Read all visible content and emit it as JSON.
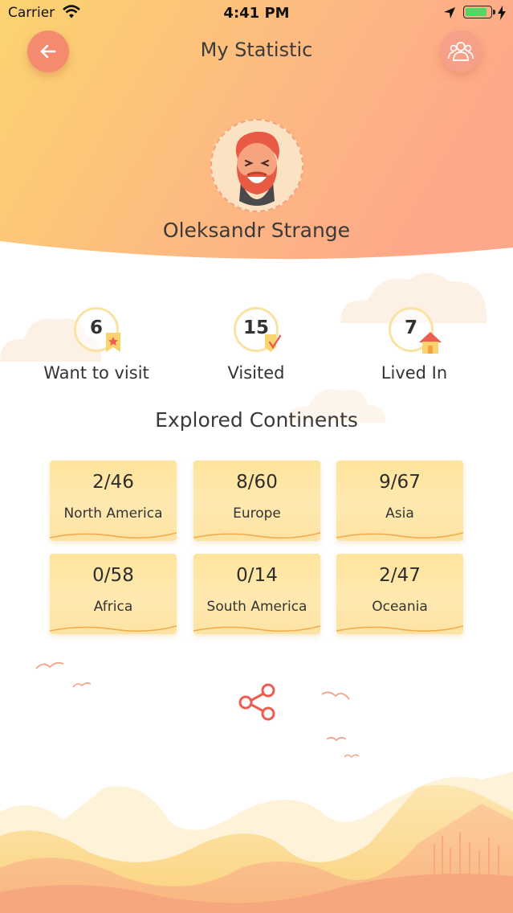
{
  "status_bar": {
    "carrier": "Carrier",
    "time": "4:41 PM",
    "battery_level": 0.92,
    "icons": [
      "wifi-icon",
      "location-arrow-icon",
      "battery-icon",
      "charging-bolt-icon"
    ]
  },
  "nav": {
    "title": "My Statistic",
    "back_icon": "arrow-left-icon",
    "friends_icon": "people-group-icon"
  },
  "profile": {
    "name": "Oleksandr Strange",
    "avatar_icon": "bearded-man-avatar"
  },
  "stats": [
    {
      "count": "6",
      "label": "Want to visit",
      "badge_icon": "bookmark-star-icon"
    },
    {
      "count": "15",
      "label": "Visited",
      "badge_icon": "badge-check-icon"
    },
    {
      "count": "7",
      "label": "Lived In",
      "badge_icon": "house-icon"
    }
  ],
  "continents": {
    "title": "Explored Continents",
    "items": [
      {
        "count": "2/46",
        "name": "North America"
      },
      {
        "count": "8/60",
        "name": "Europe"
      },
      {
        "count": "9/67",
        "name": "Asia"
      },
      {
        "count": "0/58",
        "name": "Africa"
      },
      {
        "count": "0/14",
        "name": "South America"
      },
      {
        "count": "2/47",
        "name": "Oceania"
      }
    ]
  },
  "share": {
    "icon": "share-icon"
  },
  "colors": {
    "header_gradient_start": "#fbd46f",
    "header_gradient_end": "#fda88a",
    "accent": "#f48b6f",
    "card": "#ffe49c",
    "share": "#ef5b4f"
  }
}
